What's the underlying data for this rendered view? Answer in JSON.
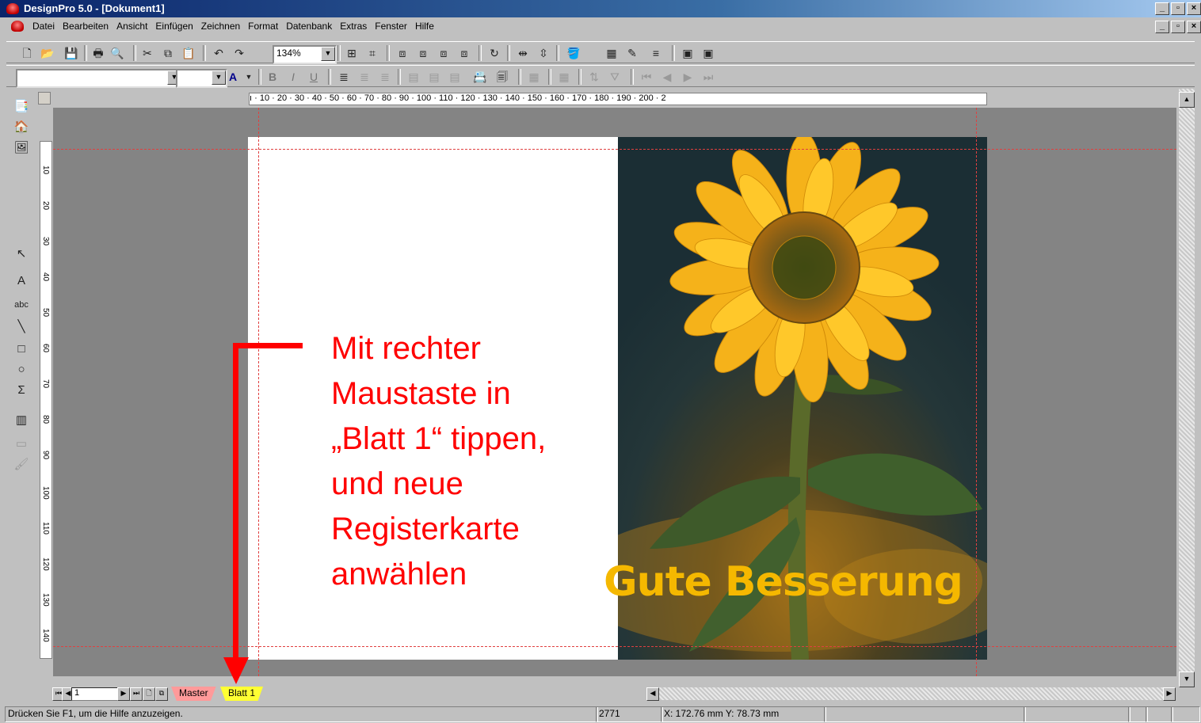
{
  "window": {
    "title": "DesignPro 5.0 - [Dokument1]"
  },
  "menu": [
    "Datei",
    "Bearbeiten",
    "Ansicht",
    "Einfügen",
    "Zeichnen",
    "Format",
    "Datenbank",
    "Extras",
    "Fenster",
    "Hilfe"
  ],
  "toolbar": {
    "zoom_value": "134%",
    "font_color_label": "A",
    "bold_label": "B",
    "italic_label": "I",
    "underline_label": "U"
  },
  "ruler": {
    "h_ticks": "ı · 10 · 20 · 30 · 40 · 50 · 60 · 70 · 80 · 90 · 100 · 110 · 120 · 130 · 140 · 150 · 160 · 170 · 180 · 190 · 200 · 2",
    "v_ticks": [
      "10",
      "20",
      "30",
      "40",
      "50",
      "60",
      "70",
      "80",
      "90",
      "100",
      "110",
      "120",
      "130",
      "140"
    ]
  },
  "document": {
    "instruction_lines": [
      "Mit rechter",
      "Maustaste in",
      "„Blatt 1“ tippen,",
      "und neue",
      "Registerkarte",
      "anwählen"
    ],
    "greeting": "Gute Besserung"
  },
  "sheets": {
    "page_number": "1",
    "tabs": [
      {
        "label": "Master",
        "color": "#ff9a9a"
      },
      {
        "label": "Blatt 1",
        "color": "#ffff33"
      }
    ]
  },
  "status": {
    "help_text": "Drücken Sie F1, um die Hilfe anzuzeigen.",
    "value": "2771",
    "coords": "X: 172.76 mm   Y: 78.73 mm"
  },
  "icons": {
    "accent_red": "#ff0000",
    "greeting_yellow": "#f5b800"
  }
}
